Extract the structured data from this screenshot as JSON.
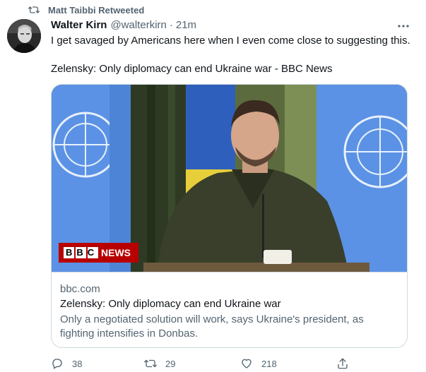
{
  "retweet_context": {
    "text": "Matt Taibbi Retweeted",
    "icon": "retweet-icon"
  },
  "tweet": {
    "author_name": "Walter Kirn",
    "author_handle": "@walterkirn",
    "separator": "·",
    "timestamp": "21m",
    "text_line1": "I get savaged by Americans here when I even come close to suggesting this.",
    "text_line2": "Zelensky: Only diplomacy can end Ukraine war - BBC News"
  },
  "card": {
    "badge_brand": "BBC",
    "badge_label": "NEWS",
    "domain": "bbc.com",
    "title": "Zelensky: Only diplomacy can end Ukraine war",
    "description": "Only a negotiated solution will work, says Ukraine's president, as fighting intensifies in Donbas."
  },
  "actions": {
    "reply_count": "38",
    "retweet_count": "29",
    "like_count": "218"
  },
  "colors": {
    "text": "#0f1419",
    "secondary": "#536471",
    "border": "#cfd9de",
    "bbc_red": "#b80000"
  }
}
